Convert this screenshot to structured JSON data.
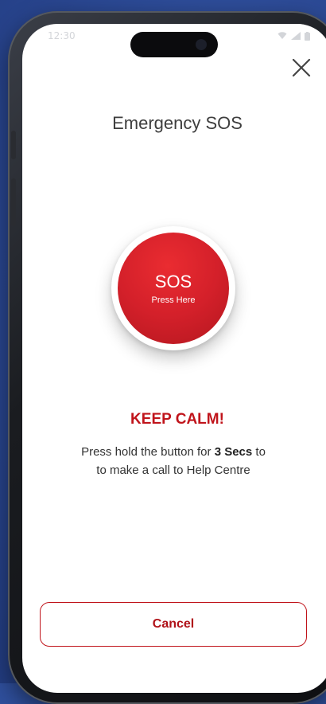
{
  "status_bar": {
    "time": "12:30",
    "icons": [
      "wifi-icon",
      "signal-icon",
      "battery-icon"
    ]
  },
  "header": {
    "title": "Emergency SOS",
    "close_icon": "close-icon"
  },
  "sos": {
    "label": "SOS",
    "sublabel": "Press Here",
    "color": "#d4202a"
  },
  "message": {
    "headline": "KEEP CALM!",
    "line1_prefix": "Press hold the button for ",
    "line1_bold": "3 Secs",
    "line1_suffix": " to",
    "line2": "to make a call to Help Centre"
  },
  "actions": {
    "cancel_label": "Cancel"
  },
  "colors": {
    "accent": "#c0141b",
    "background": "#2f4f9c"
  }
}
